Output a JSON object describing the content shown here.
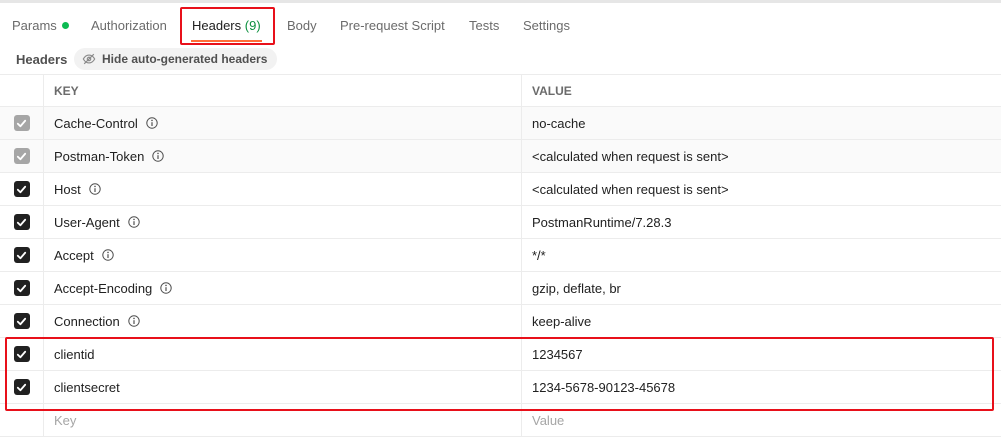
{
  "tabs": [
    {
      "label": "Params",
      "has_dot": true
    },
    {
      "label": "Authorization"
    },
    {
      "label": "Headers",
      "count": "(9)",
      "active": true
    },
    {
      "label": "Body"
    },
    {
      "label": "Pre-request Script"
    },
    {
      "label": "Tests"
    },
    {
      "label": "Settings"
    }
  ],
  "subhead": {
    "title": "Headers",
    "hide_button": "Hide auto-generated headers"
  },
  "table": {
    "key_header": "KEY",
    "value_header": "VALUE",
    "rows": [
      {
        "key": "Cache-Control",
        "value": "no-cache",
        "checked": true,
        "auto": true,
        "info": true
      },
      {
        "key": "Postman-Token",
        "value": "<calculated when request is sent>",
        "checked": true,
        "auto": true,
        "info": true
      },
      {
        "key": "Host",
        "value": "<calculated when request is sent>",
        "checked": true,
        "info": true
      },
      {
        "key": "User-Agent",
        "value": "PostmanRuntime/7.28.3",
        "checked": true,
        "info": true
      },
      {
        "key": "Accept",
        "value": "*/*",
        "checked": true,
        "info": true
      },
      {
        "key": "Accept-Encoding",
        "value": "gzip, deflate, br",
        "checked": true,
        "info": true
      },
      {
        "key": "Connection",
        "value": "keep-alive",
        "checked": true,
        "info": true
      },
      {
        "key": "clientid",
        "value": "1234567",
        "checked": true
      },
      {
        "key": "clientsecret",
        "value": "1234-5678-90123-45678",
        "checked": true
      }
    ],
    "new_row": {
      "key_placeholder": "Key",
      "value_placeholder": "Value"
    }
  },
  "colors": {
    "accent": "#ff6c37",
    "highlight": "#e8101a",
    "status_dot": "#0cbb52"
  }
}
